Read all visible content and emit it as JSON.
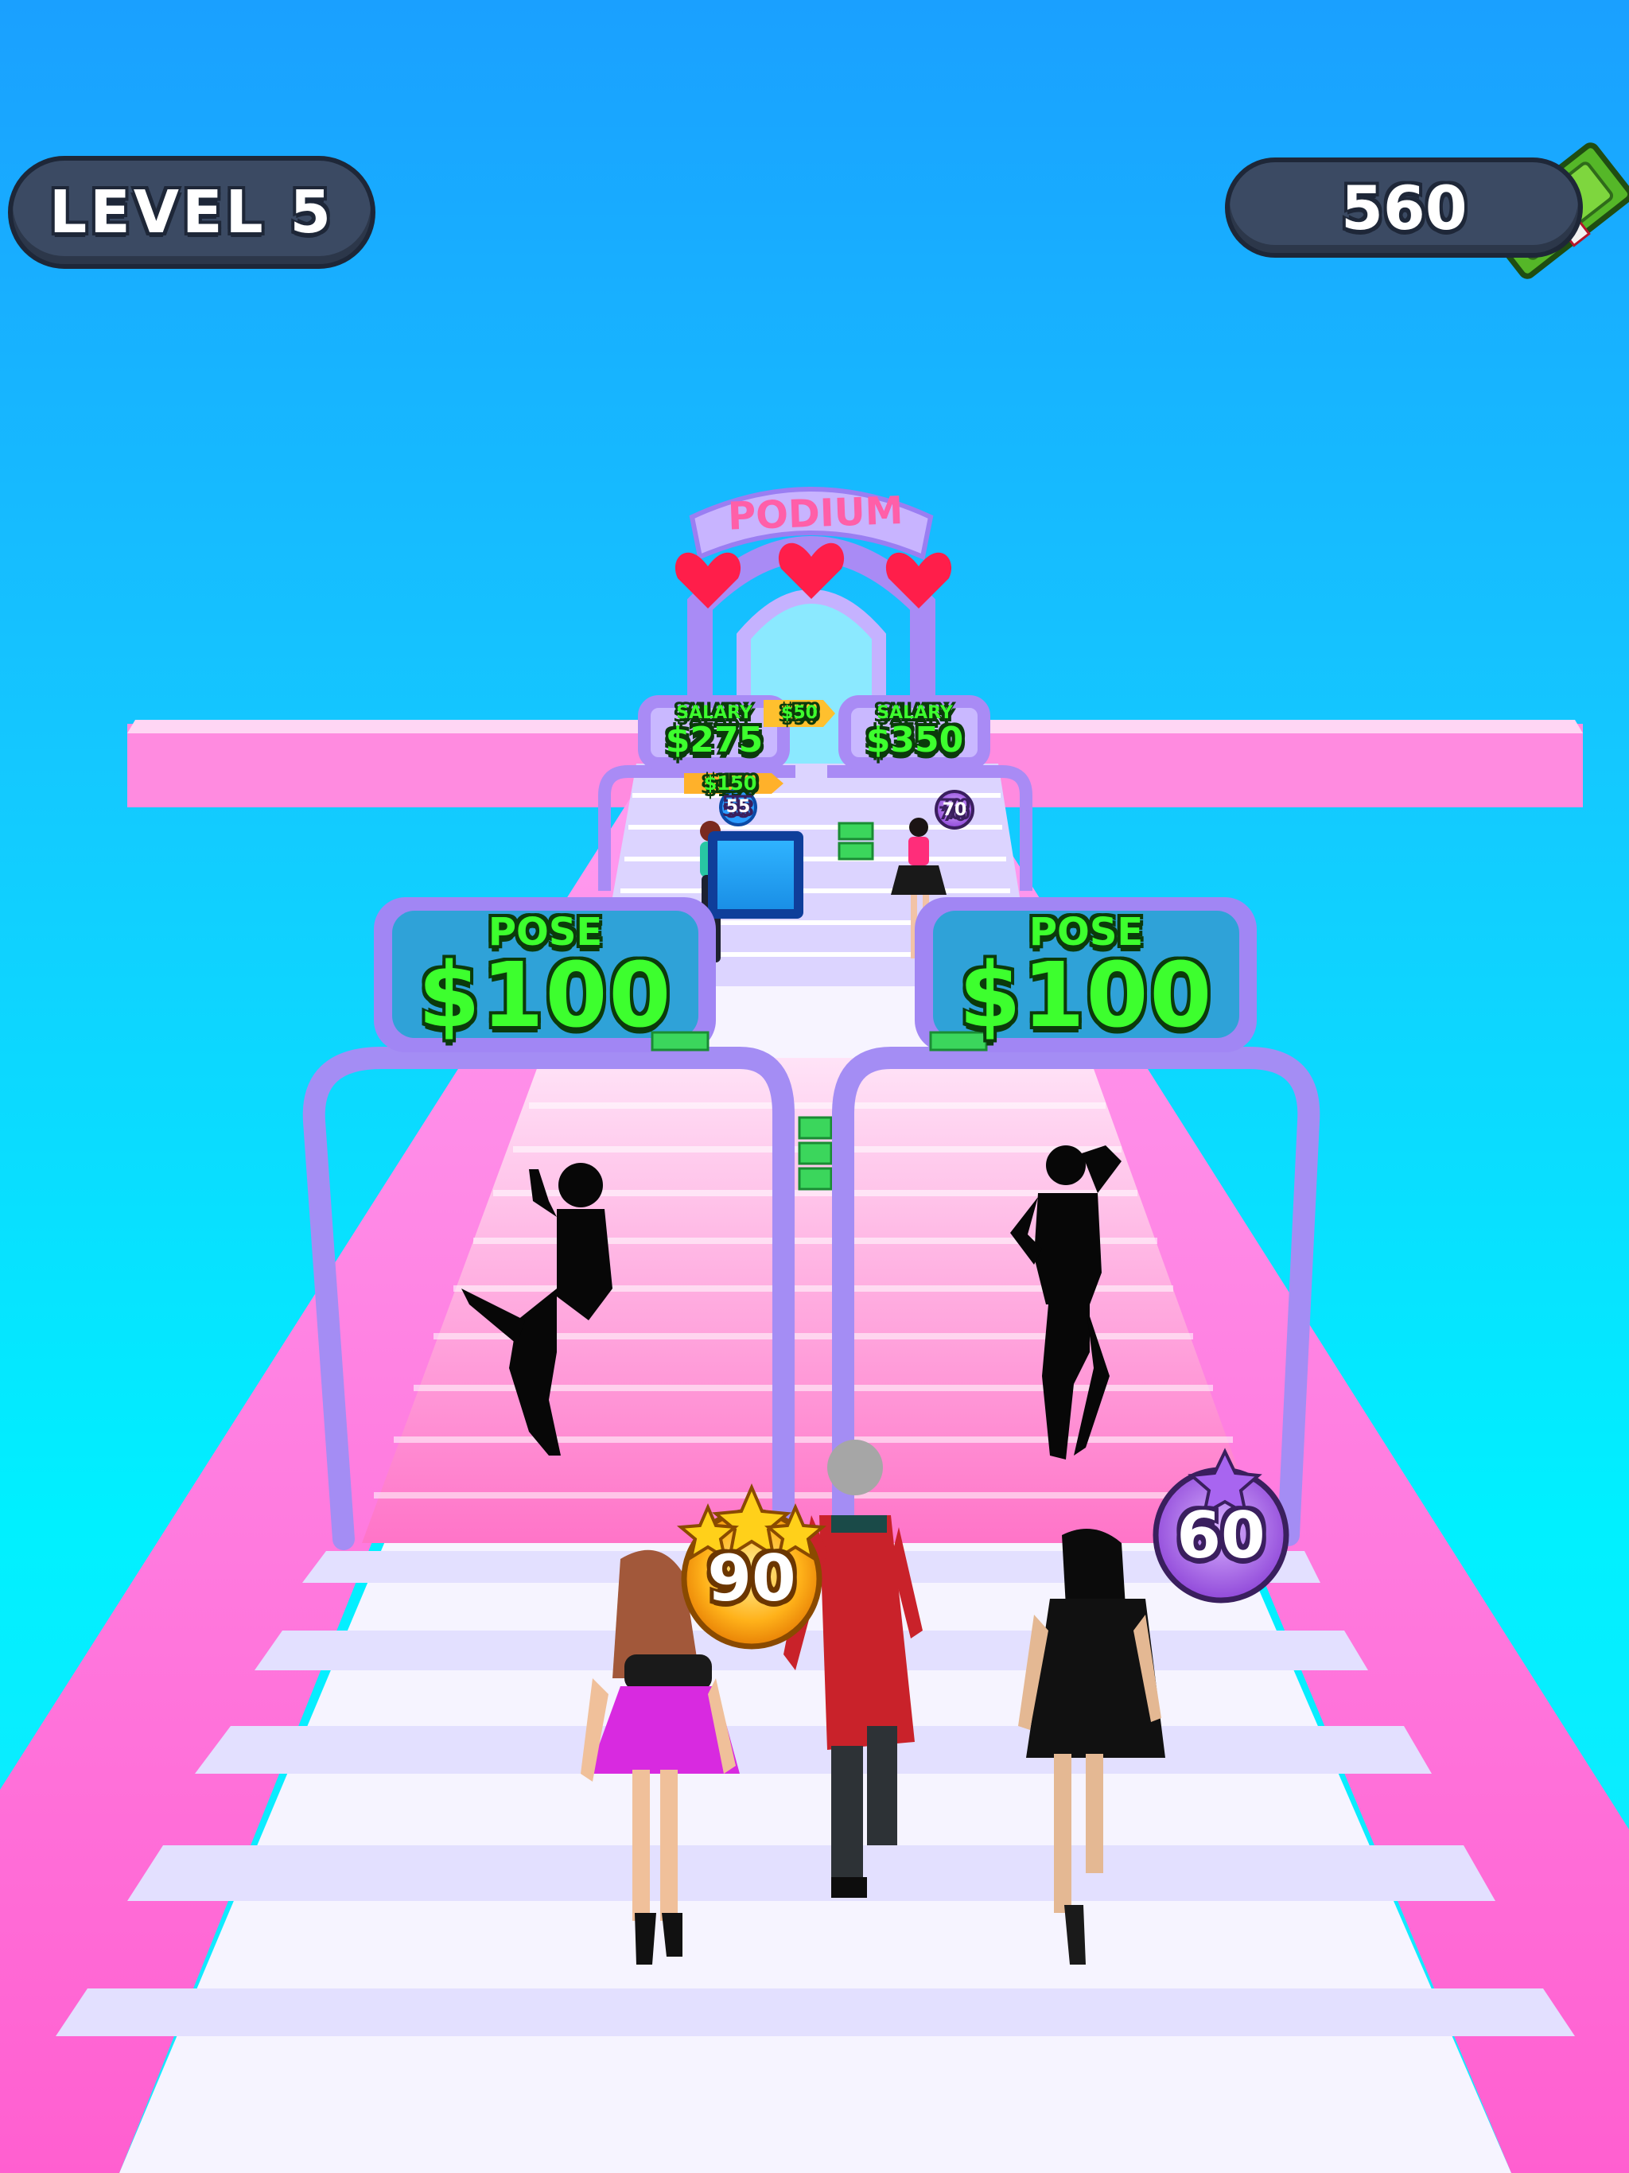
{
  "hud": {
    "level_label": "LEVEL 5",
    "money_value": "560",
    "money_icon": "cash-bundle-icon"
  },
  "podium": {
    "label": "PODIUM"
  },
  "gates": {
    "left": {
      "title": "POSE",
      "amount": "$100"
    },
    "right": {
      "title": "POSE",
      "amount": "$100"
    }
  },
  "salary_gates": {
    "left": {
      "title": "SALARY",
      "amount": "$275"
    },
    "right": {
      "title": "SALARY",
      "amount": "$350"
    }
  },
  "far_price_tags": [
    "$50",
    "$150"
  ],
  "rating_badges": {
    "player_left": "90",
    "player_right": "60",
    "far_left": "55",
    "far_right": "70"
  },
  "colors": {
    "sky_top": "#1aa0ff",
    "sky_bottom": "#00f0ff",
    "runway_pink": "#ff6fd8",
    "runway_white": "#f4f2ff",
    "gate_purple": "#9b7bf2",
    "money_green": "#3dff2e",
    "hud_pill": "#3b4a63"
  }
}
